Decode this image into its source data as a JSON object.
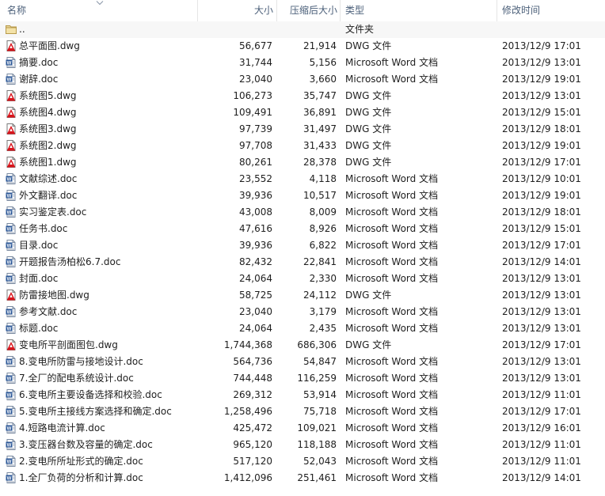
{
  "columns": {
    "name": "名称",
    "size": "大小",
    "compressed": "压缩后大小",
    "type": "类型",
    "modified": "修改时间"
  },
  "files": [
    {
      "name": "..",
      "size": "",
      "compressed": "",
      "type": "文件夹",
      "modified": "",
      "icon": "parent-folder-icon"
    },
    {
      "name": "总平面图.dwg",
      "size": "56,677",
      "compressed": "21,914",
      "type": "DWG 文件",
      "modified": "2013/12/9 17:01",
      "icon": "dwg-file-icon"
    },
    {
      "name": "摘要.doc",
      "size": "31,744",
      "compressed": "5,156",
      "type": "Microsoft Word 文档",
      "modified": "2013/12/9 13:01",
      "icon": "word-doc-icon"
    },
    {
      "name": "谢辞.doc",
      "size": "23,040",
      "compressed": "3,660",
      "type": "Microsoft Word 文档",
      "modified": "2013/12/9 19:01",
      "icon": "word-doc-icon"
    },
    {
      "name": "系统图5.dwg",
      "size": "106,273",
      "compressed": "35,747",
      "type": "DWG 文件",
      "modified": "2013/12/9 13:01",
      "icon": "dwg-file-icon"
    },
    {
      "name": "系统图4.dwg",
      "size": "109,491",
      "compressed": "36,891",
      "type": "DWG 文件",
      "modified": "2013/12/9 15:01",
      "icon": "dwg-file-icon"
    },
    {
      "name": "系统图3.dwg",
      "size": "97,739",
      "compressed": "31,497",
      "type": "DWG 文件",
      "modified": "2013/12/9 18:01",
      "icon": "dwg-file-icon"
    },
    {
      "name": "系统图2.dwg",
      "size": "97,708",
      "compressed": "31,433",
      "type": "DWG 文件",
      "modified": "2013/12/9 19:01",
      "icon": "dwg-file-icon"
    },
    {
      "name": "系统图1.dwg",
      "size": "80,261",
      "compressed": "28,378",
      "type": "DWG 文件",
      "modified": "2013/12/9 17:01",
      "icon": "dwg-file-icon"
    },
    {
      "name": "文献综述.doc",
      "size": "23,552",
      "compressed": "4,118",
      "type": "Microsoft Word 文档",
      "modified": "2013/12/9 10:01",
      "icon": "word-doc-icon"
    },
    {
      "name": "外文翻译.doc",
      "size": "39,936",
      "compressed": "10,517",
      "type": "Microsoft Word 文档",
      "modified": "2013/12/9 19:01",
      "icon": "word-doc-icon"
    },
    {
      "name": "实习鉴定表.doc",
      "size": "43,008",
      "compressed": "8,009",
      "type": "Microsoft Word 文档",
      "modified": "2013/12/9 18:01",
      "icon": "word-doc-icon"
    },
    {
      "name": "任务书.doc",
      "size": "47,616",
      "compressed": "8,926",
      "type": "Microsoft Word 文档",
      "modified": "2013/12/9 15:01",
      "icon": "word-doc-icon"
    },
    {
      "name": "目录.doc",
      "size": "39,936",
      "compressed": "6,822",
      "type": "Microsoft Word 文档",
      "modified": "2013/12/9 17:01",
      "icon": "word-doc-icon"
    },
    {
      "name": "开题报告汤柏松6.7.doc",
      "size": "82,432",
      "compressed": "22,841",
      "type": "Microsoft Word 文档",
      "modified": "2013/12/9 14:01",
      "icon": "word-doc-icon"
    },
    {
      "name": "封面.doc",
      "size": "24,064",
      "compressed": "2,330",
      "type": "Microsoft Word 文档",
      "modified": "2013/12/9 13:01",
      "icon": "word-doc-icon"
    },
    {
      "name": "防雷接地图.dwg",
      "size": "58,725",
      "compressed": "24,112",
      "type": "DWG 文件",
      "modified": "2013/12/9 13:01",
      "icon": "dwg-file-icon"
    },
    {
      "name": "参考文献.doc",
      "size": "23,040",
      "compressed": "3,179",
      "type": "Microsoft Word 文档",
      "modified": "2013/12/9 13:01",
      "icon": "word-doc-icon"
    },
    {
      "name": "标题.doc",
      "size": "24,064",
      "compressed": "2,435",
      "type": "Microsoft Word 文档",
      "modified": "2013/12/9 13:01",
      "icon": "word-doc-icon"
    },
    {
      "name": "变电所平剖面图包.dwg",
      "size": "1,744,368",
      "compressed": "686,306",
      "type": "DWG 文件",
      "modified": "2013/12/9 17:01",
      "icon": "dwg-file-icon"
    },
    {
      "name": "8.变电所防雷与接地设计.doc",
      "size": "564,736",
      "compressed": "54,847",
      "type": "Microsoft Word 文档",
      "modified": "2013/12/9 13:01",
      "icon": "word-doc-icon"
    },
    {
      "name": "7.全厂的配电系统设计.doc",
      "size": "744,448",
      "compressed": "116,259",
      "type": "Microsoft Word 文档",
      "modified": "2013/12/9 13:01",
      "icon": "word-doc-icon"
    },
    {
      "name": "6.变电所主要设备选择和校验.doc",
      "size": "269,312",
      "compressed": "53,914",
      "type": "Microsoft Word 文档",
      "modified": "2013/12/9 11:01",
      "icon": "word-doc-icon"
    },
    {
      "name": "5.变电所主接线方案选择和确定.doc",
      "size": "1,258,496",
      "compressed": "75,718",
      "type": "Microsoft Word 文档",
      "modified": "2013/12/9 17:01",
      "icon": "word-doc-icon"
    },
    {
      "name": "4.短路电流计算.doc",
      "size": "425,472",
      "compressed": "109,021",
      "type": "Microsoft Word 文档",
      "modified": "2013/12/9 16:01",
      "icon": "word-doc-icon"
    },
    {
      "name": "3.变压器台数及容量的确定.doc",
      "size": "965,120",
      "compressed": "118,188",
      "type": "Microsoft Word 文档",
      "modified": "2013/12/9 11:01",
      "icon": "word-doc-icon"
    },
    {
      "name": "2.变电所所址形式的确定.doc",
      "size": "517,120",
      "compressed": "52,043",
      "type": "Microsoft Word 文档",
      "modified": "2013/12/9 11:01",
      "icon": "word-doc-icon"
    },
    {
      "name": "1.全厂负荷的分析和计算.doc",
      "size": "1,412,096",
      "compressed": "251,461",
      "type": "Microsoft Word 文档",
      "modified": "2013/12/9 14:01",
      "icon": "word-doc-icon"
    }
  ]
}
